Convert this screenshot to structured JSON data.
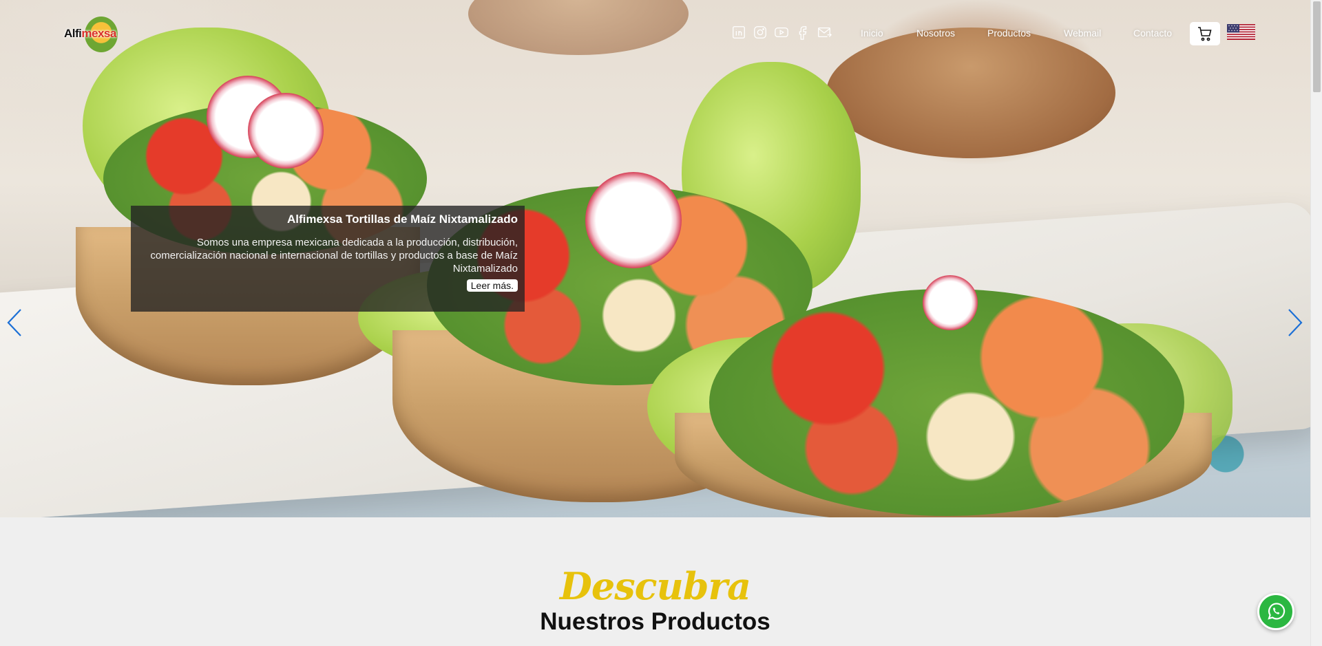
{
  "header": {
    "logo": {
      "text_main": "Alfi",
      "text_accent": "mexsa"
    },
    "socials": [
      {
        "icon": "linkedin-icon"
      },
      {
        "icon": "instagram-icon"
      },
      {
        "icon": "youtube-icon"
      },
      {
        "icon": "facebook-icon"
      },
      {
        "icon": "mail-icon"
      }
    ],
    "nav": {
      "inicio": "Inicio",
      "nosotros": "Nosotros",
      "productos": "Productos",
      "webmail": "Webmail",
      "contacto": "Contacto"
    },
    "cart_icon": "cart-icon",
    "language_flag": "us-flag-icon"
  },
  "slider": {
    "caption_title": "Alfimexsa Tortillas de Maíz Nixtamalizado",
    "caption_text": "Somos una empresa mexicana dedicada a la producción, distribución, comercialización nacional e internacional de tortillas y productos a base de Maíz Nixtamalizado",
    "read_more": "Leer más."
  },
  "section": {
    "script_title": "Descubra",
    "title": "Nuestros Productos"
  },
  "colors": {
    "accent_yellow": "#e7c20c",
    "whatsapp_green": "#2bb741",
    "arrow_blue": "#1b6fd6"
  }
}
